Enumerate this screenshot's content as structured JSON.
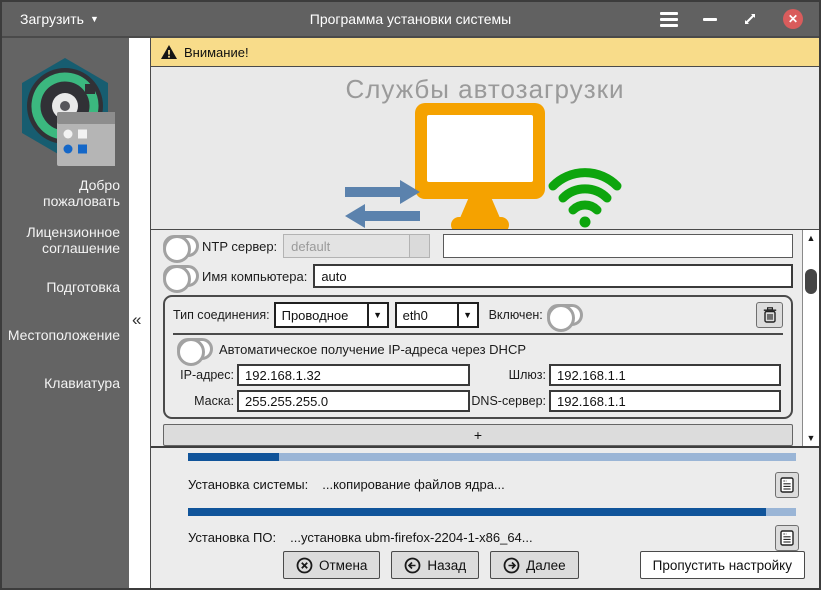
{
  "titlebar": {
    "menu_label": "Загрузить",
    "title": "Программа установки системы",
    "close_glyph": "✕"
  },
  "sidebar": {
    "items": [
      {
        "label": "Добро\nпожаловать"
      },
      {
        "label": "Лицензионное\nсоглашение"
      },
      {
        "label": "Подготовка"
      },
      {
        "label": "Местоположение"
      },
      {
        "label": "Клавиатура"
      }
    ],
    "collapse_glyph": "«"
  },
  "warning": {
    "text": "Внимание!"
  },
  "hero": {
    "title": "Службы автозагрузки"
  },
  "form": {
    "ntp": {
      "label": "NTP сервер:",
      "value": "default",
      "enabled": false,
      "extra_value": ""
    },
    "hostname": {
      "label": "Имя компьютера:",
      "value": "auto",
      "enabled": false
    },
    "connection": {
      "type_label": "Тип соединения:",
      "type_value": "Проводное",
      "iface_value": "eth0",
      "enabled_label": "Включен:",
      "enabled": false,
      "dhcp_label": "Автоматическое получение IP-адреса через DHCP",
      "dhcp_enabled": false,
      "ip_label": "IP-адрес:",
      "ip_value": "192.168.1.32",
      "gateway_label": "Шлюз:",
      "gateway_value": "192.168.1.1",
      "mask_label": "Маска:",
      "mask_value": "255.255.255.0",
      "dns_label": "DNS-сервер:",
      "dns_value": "192.168.1.1"
    },
    "add_button_label": "+"
  },
  "progress": {
    "system": {
      "label": "Установка системы:",
      "status": "...копирование файлов ядра...",
      "percent": 15
    },
    "software": {
      "label": "Установка ПО:",
      "status": "...установка ubm-firefox-2204-1-x86_64...",
      "percent": 95
    }
  },
  "buttons": {
    "cancel": "Отмена",
    "back": "Назад",
    "next": "Далее",
    "skip": "Пропустить настройку"
  },
  "icons": {
    "dropdown": "▼",
    "menu_caret": "▼",
    "scroll_up": "▲",
    "scroll_down": "▼"
  },
  "colors": {
    "titlebar": "#616161",
    "sidebar": "#646464",
    "warning_bg": "#f8dc8a",
    "close_red": "#d95c5c",
    "progress_fill": "#10549a",
    "progress_track": "#9ab5d6",
    "monitor_orange": "#f5a200",
    "wifi_green": "#0da50d",
    "arrow_blue": "#5b82ad",
    "logo_teal": "#175d70",
    "logo_ring": "#3bb87f"
  }
}
